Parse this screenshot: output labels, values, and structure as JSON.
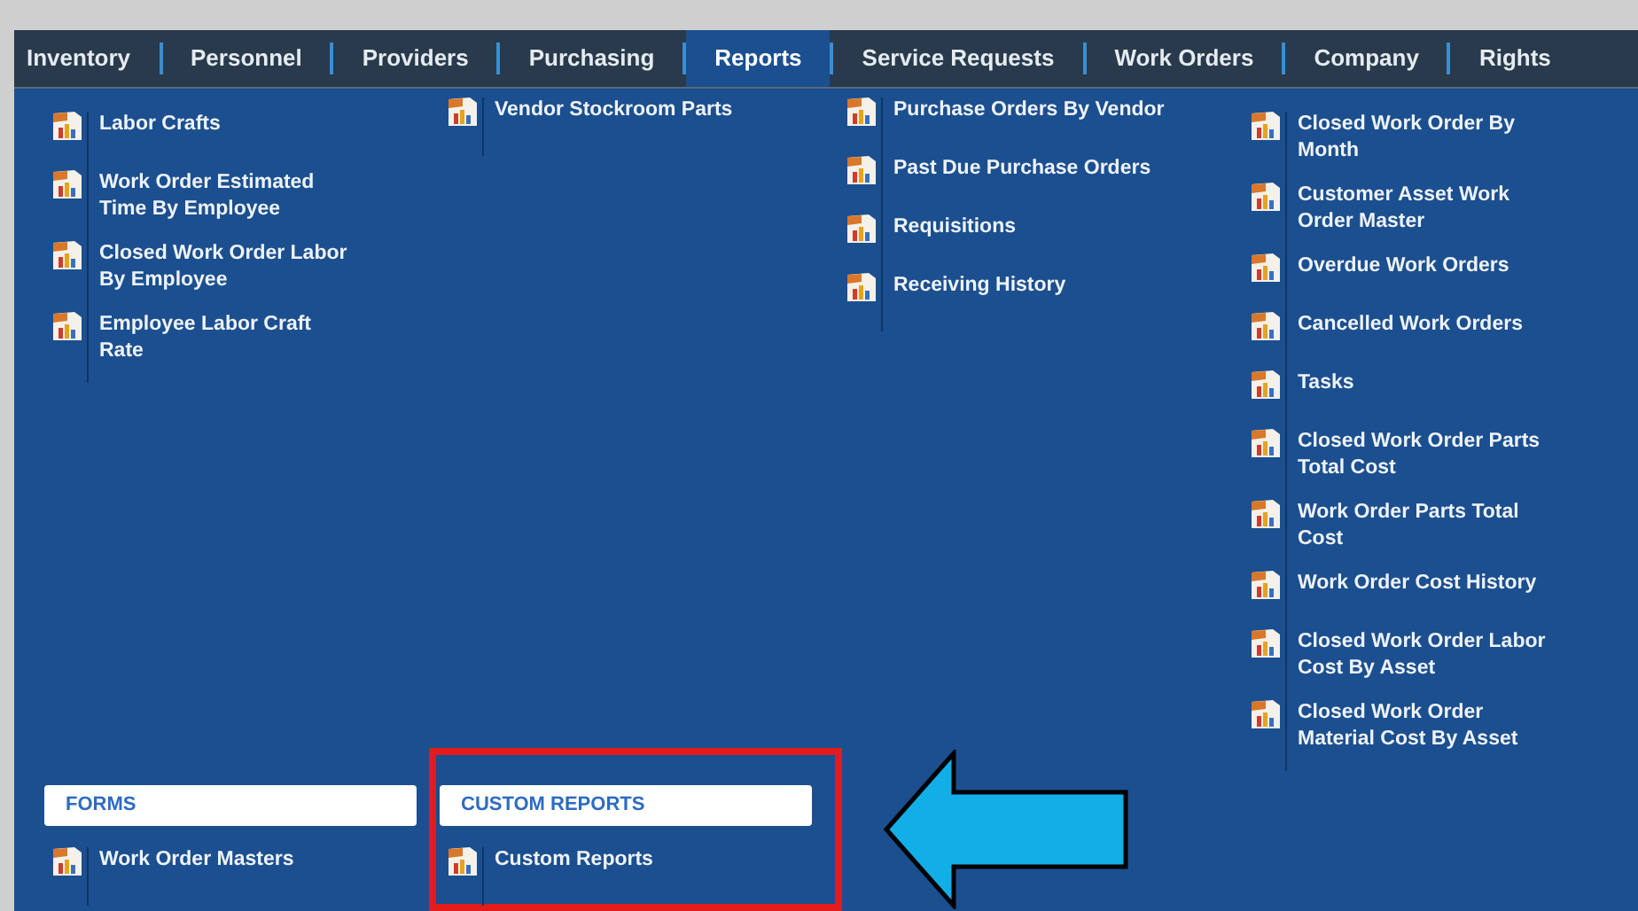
{
  "nav": {
    "tabs": [
      {
        "label": "Inventory",
        "selected": false
      },
      {
        "label": "Personnel",
        "selected": false
      },
      {
        "label": "Providers",
        "selected": false
      },
      {
        "label": "Purchasing",
        "selected": false
      },
      {
        "label": "Reports",
        "selected": true
      },
      {
        "label": "Service Requests",
        "selected": false
      },
      {
        "label": "Work Orders",
        "selected": false
      },
      {
        "label": "Company",
        "selected": false
      },
      {
        "label": "Rights",
        "selected": false
      }
    ]
  },
  "report_columns": [
    {
      "items": [
        "Labor Crafts",
        "Work Order Estimated Time By Employee",
        "Closed Work Order Labor By Employee",
        "Employee Labor Craft Rate"
      ]
    },
    {
      "items": [
        "Vendor Stockroom Parts"
      ]
    },
    {
      "items": [
        "Purchase Orders By Vendor",
        "Past Due Purchase Orders",
        "Requisitions",
        "Receiving History"
      ]
    },
    {
      "items": [
        "Closed Work Order By Month",
        "Customer Asset Work Order Master",
        "Overdue Work Orders",
        "Cancelled Work Orders",
        "Tasks",
        "Closed Work Order Parts Total Cost",
        "Work Order Parts Total Cost",
        "Work Order Cost History",
        "Closed Work Order Labor Cost By Asset",
        "Closed Work Order Material Cost By Asset"
      ]
    }
  ],
  "sections": [
    {
      "title": "FORMS",
      "highlighted": false,
      "items": [
        "Work Order Masters"
      ]
    },
    {
      "title": "CUSTOM REPORTS",
      "highlighted": true,
      "items": [
        "Custom Reports"
      ]
    }
  ],
  "annotations": [
    {
      "kind": "arrow"
    }
  ]
}
